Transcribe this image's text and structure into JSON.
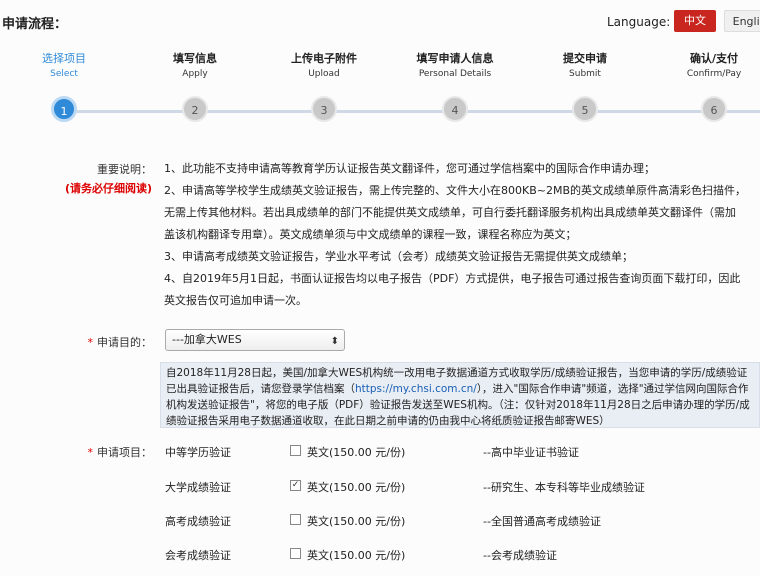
{
  "header": {
    "flow_title": "申请流程：",
    "language_label": "Language:",
    "lang_zh": "中文",
    "lang_en": "Englis"
  },
  "steps": [
    {
      "zh": "选择项目",
      "en": "Select",
      "num": "1",
      "active": true
    },
    {
      "zh": "填写信息",
      "en": "Apply",
      "num": "2",
      "active": false
    },
    {
      "zh": "上传电子附件",
      "en": "Upload",
      "num": "3",
      "active": false
    },
    {
      "zh": "填写申请人信息",
      "en": "Personal Details",
      "num": "4",
      "active": false
    },
    {
      "zh": "提交申请",
      "en": "Submit",
      "num": "5",
      "active": false
    },
    {
      "zh": "确认/支付",
      "en": "Confirm/Pay",
      "num": "6",
      "active": false
    }
  ],
  "notes": {
    "label": "重要说明：",
    "warning": "(请务必仔细阅读)",
    "lines": [
      "1、此功能不支持申请高等教育学历认证报告英文翻译件，您可通过学信档案中的国际合作申请办理；",
      "2、申请高等学校学生成绩英文验证报告，需上传完整的、文件大小在800KB~2MB的英文成绩单原件高清彩色扫描件，",
      "无需上传其他材料。若出具成绩单的部门不能提供英文成绩单，可自行委托翻译服务机构出具成绩单英文翻译件（需加",
      "盖该机构翻译专用章）。英文成绩单须与中文成绩单的课程一致，课程名称应为英文；",
      "3、申请高考成绩英文验证报告，学业水平考试（会考）成绩英文验证报告无需提供英文成绩单；",
      "4、自2019年5月1日起，书面认证报告均以电子报告（PDF）方式提供，电子报告可通过报告查询页面下载打印，因此",
      "英文报告仅可追加申请一次。"
    ]
  },
  "purpose": {
    "star": "*",
    "label": "申请目的：",
    "selected": "---加拿大WES",
    "caret": "⬍"
  },
  "wes_notice": {
    "text_1": "自2018年11月28日起，美国/加拿大WES机构统一改用电子数据通道方式收取学历/成绩验证报告，当您申请的学历/成绩验证已出具验证报告后，请您登录学信档案（",
    "link": "https://my.chsi.com.cn/",
    "text_2": "），进入\"国际合作申请\"频道，选择\"通过学信网向国际合作机构发送验证报告\"，将您的电子版（PDF）验证报告发送至WES机构。（注：仅针对2018年11月28日之后申请办理的学历/成绩验证报告采用电子数据通道收取，在此日期之前申请的仍由我中心将纸质验证报告邮寄WES）"
  },
  "items": {
    "star": "*",
    "label": "申请项目：",
    "rows": [
      {
        "name": "中等学历验证",
        "check": "",
        "option": "英文(150.00 元/份)",
        "desc": "--高中毕业证书验证"
      },
      {
        "name": "大学成绩验证",
        "check": "✓",
        "option": "英文(150.00 元/份)",
        "desc": "--研究生、本专科等毕业成绩验证"
      },
      {
        "name": "高考成绩验证",
        "check": "",
        "option": "英文(150.00 元/份)",
        "desc": "--全国普通高考成绩验证"
      },
      {
        "name": "会考成绩验证",
        "check": "",
        "option": "英文(150.00 元/份)",
        "desc": "--会考成绩验证"
      }
    ]
  },
  "colors": {
    "accent": "#2f8ad8",
    "danger": "#c8261e"
  }
}
